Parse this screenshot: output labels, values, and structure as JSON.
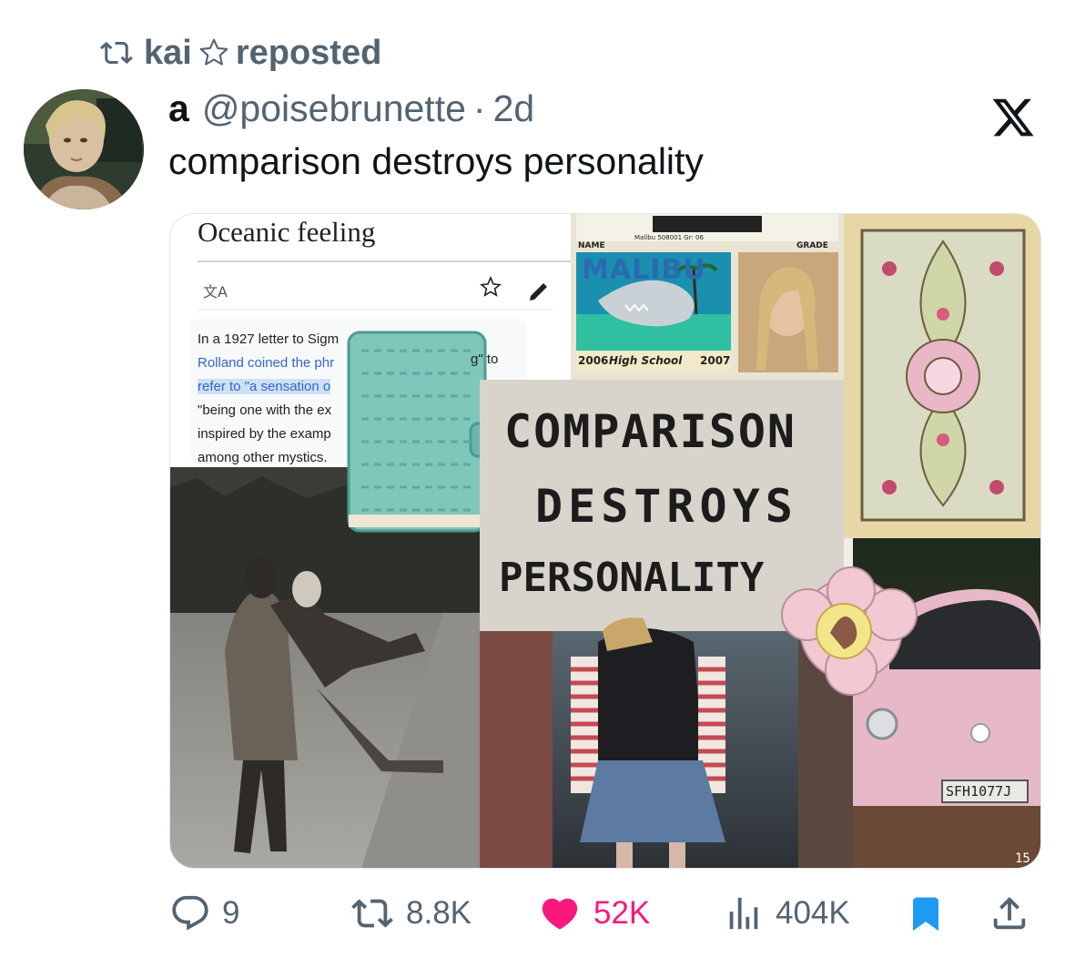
{
  "repost": {
    "user": "kai",
    "suffix": "reposted"
  },
  "tweet": {
    "display_name": "a",
    "handle": "@poisebrunette",
    "separator": "·",
    "time": "2d",
    "text": "comparison destroys personality"
  },
  "media": {
    "wiki_title": "Oceanic feeling",
    "wiki_translate_icon": "文A",
    "wiki_lines": [
      "In a 1927 letter to Sigm",
      "Rolland coined the phr",
      "refer to \"a sensation o",
      "\"being one with the ex",
      "inspired by the examp",
      "among other mystics."
    ],
    "wiki_right_fragments": [
      "g\" to"
    ],
    "id_card": {
      "name_label": "NAME",
      "grade_label": "GRADE",
      "school_line": "Malibu 508001 Gr: 06",
      "logo": "MALIBU",
      "year_start": "2006",
      "school": "High School",
      "year_end": "2007"
    },
    "sign_lines": [
      "COMPARISON",
      "DESTROYS",
      "PERSONALITY"
    ],
    "plate": "SFH1077J",
    "corner_number": "15"
  },
  "actions": {
    "replies": "9",
    "reposts": "8.8K",
    "likes": "52K",
    "views": "404K"
  },
  "colors": {
    "muted": "#536471",
    "like": "#f91880",
    "bookmark": "#1d9bf0",
    "text": "#0f1419"
  },
  "icons": [
    "repost-icon",
    "star-icon",
    "x-logo-icon",
    "reply-icon",
    "heart-icon",
    "views-icon",
    "bookmark-icon",
    "share-icon"
  ]
}
